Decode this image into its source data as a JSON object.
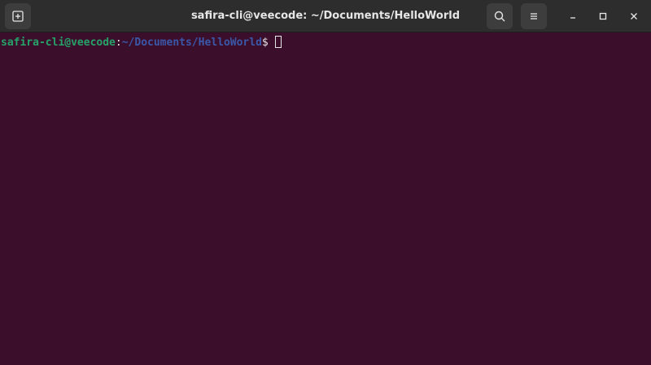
{
  "window": {
    "title": "safira-cli@veecode: ~/Documents/HelloWorld"
  },
  "titlebar": {
    "new_tab_icon": "new-tab-icon",
    "search_icon": "search-icon",
    "menu_icon": "hamburger-menu-icon",
    "minimize_icon": "minimize-icon",
    "maximize_icon": "maximize-icon",
    "close_icon": "close-icon"
  },
  "terminal": {
    "prompt_user_host": "safira-cli@veecode",
    "prompt_separator": ":",
    "prompt_path": "~/Documents/HelloWorld",
    "prompt_symbol": "$"
  },
  "colors": {
    "background": "#3b0f2b",
    "titlebar": "#2d2d2d",
    "user_host": "#26a269",
    "path": "#3a57a8",
    "text": "#e6e6e6"
  }
}
